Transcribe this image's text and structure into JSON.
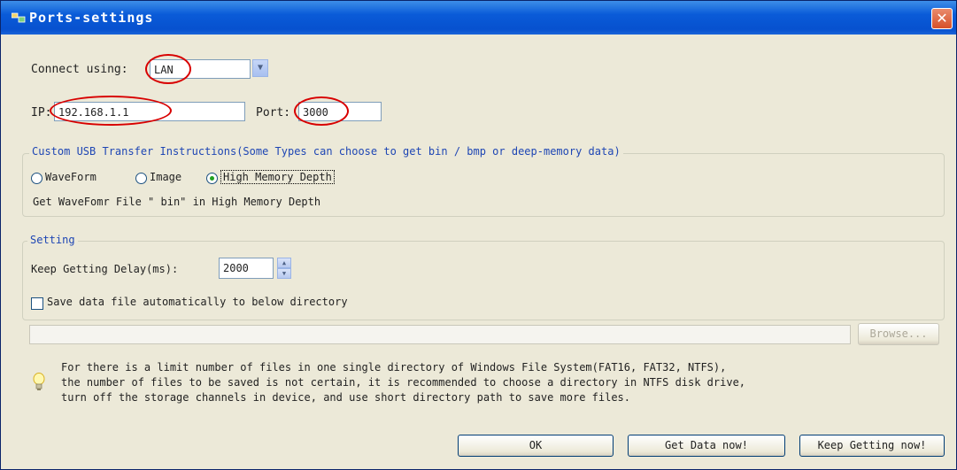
{
  "window": {
    "title": "Ports-settings",
    "close_symbol": "✕"
  },
  "connection": {
    "connect_using_label": "Connect using:",
    "connect_using_value": "LAN",
    "ip_label": "IP:",
    "ip_value": "192.168.1.1",
    "port_label": "Port:",
    "port_value": "3000"
  },
  "usb_group": {
    "legend": "Custom USB Transfer Instructions(Some Types can choose to get bin / bmp or deep-memory data)",
    "options": [
      "WaveForm",
      "Image",
      "High Memory Depth"
    ],
    "selected": "High Memory Depth",
    "description": "Get WaveFomr File \" bin\" in High Memory Depth"
  },
  "setting_group": {
    "legend": "Setting",
    "delay_label": "Keep Getting Delay(ms):",
    "delay_value": "2000",
    "save_checkbox_label": "Save data file automatically to below directory",
    "save_checked": false,
    "directory_value": "",
    "browse_label": "Browse..."
  },
  "info": {
    "icon": "lightbulb-icon",
    "lines": [
      "For there is a limit number of files in one single directory of Windows File System(FAT16, FAT32, NTFS),",
      "the number of  files to be saved is not certain,  it is recommended to choose a directory in NTFS disk drive,",
      "turn off the storage channels in device, and use short directory path to save more files."
    ]
  },
  "buttons": {
    "ok": "OK",
    "get_data_now": "Get Data now!",
    "keep_getting_now": "Keep Getting now!"
  },
  "colors": {
    "highlight_circle": "#d80000",
    "titlebar": "#0a5bd8",
    "legend_text": "#1e46b4"
  }
}
